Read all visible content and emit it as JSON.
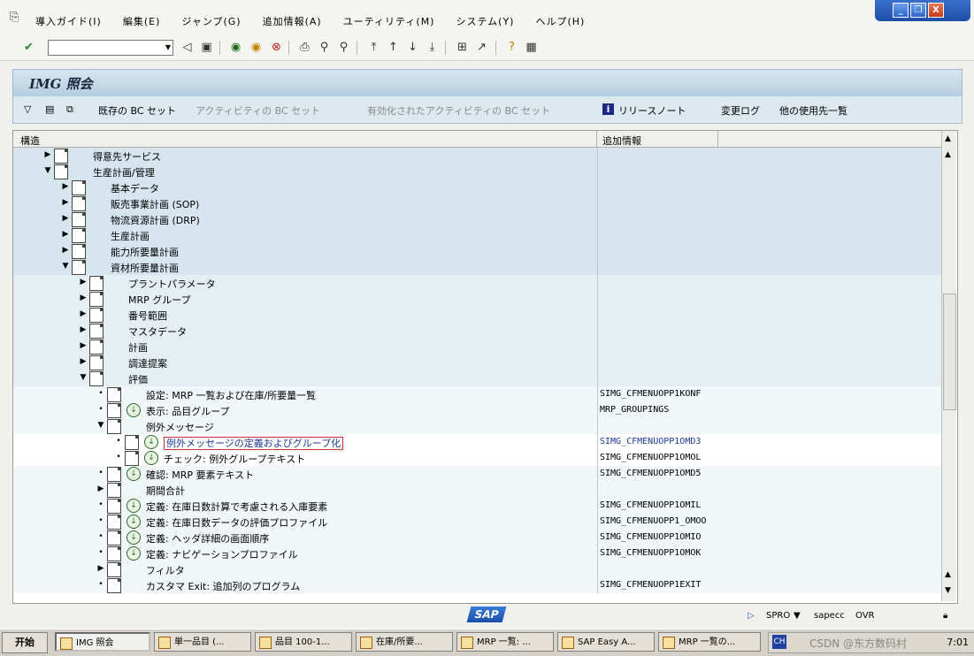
{
  "menubar": {
    "items": [
      "導入ガイド(I)",
      "編集(E)",
      "ジャンプ(G)",
      "追加情報(A)",
      "ユーティリティ(M)",
      "システム(Y)",
      "ヘルプ(H)"
    ]
  },
  "window_controls": {
    "minimize": "_",
    "restore": "❐",
    "close": "X"
  },
  "toolbar": {
    "command_value": ""
  },
  "title": "IMG 照会",
  "app_toolbar": {
    "existing_bc_sets": "既存の BC セット",
    "activity_bc_sets": "アクティビティの BC セット",
    "activated_bc_sets": "有効化されたアクティビティの BC セット",
    "release_notes": "リリースノート",
    "change_log": "変更ログ",
    "where_used": "他の使用先一覧"
  },
  "tree": {
    "headers": {
      "structure": "構造",
      "additional_info": "追加情報"
    },
    "rows": [
      {
        "level": 0,
        "expander": "▶",
        "icon": "doc",
        "clock": false,
        "label": "得意先サービス",
        "code": "",
        "bg": "bg1"
      },
      {
        "level": 0,
        "expander": "▼",
        "icon": "doc",
        "clock": false,
        "label": "生産計画/管理",
        "code": "",
        "bg": "bg1"
      },
      {
        "level": 1,
        "expander": "▶",
        "icon": "doc",
        "clock": false,
        "label": "基本データ",
        "code": "",
        "bg": "bg1"
      },
      {
        "level": 1,
        "expander": "▶",
        "icon": "doc",
        "clock": false,
        "label": "販売事業計画 (SOP)",
        "code": "",
        "bg": "bg1"
      },
      {
        "level": 1,
        "expander": "▶",
        "icon": "doc",
        "clock": false,
        "label": "物流資源計画 (DRP)",
        "code": "",
        "bg": "bg1"
      },
      {
        "level": 1,
        "expander": "▶",
        "icon": "doc",
        "clock": false,
        "label": "生産計画",
        "code": "",
        "bg": "bg1"
      },
      {
        "level": 1,
        "expander": "▶",
        "icon": "doc",
        "clock": false,
        "label": "能力所要量計画",
        "code": "",
        "bg": "bg1"
      },
      {
        "level": 1,
        "expander": "▼",
        "icon": "doc",
        "clock": false,
        "label": "資材所要量計画",
        "code": "",
        "bg": "bg1"
      },
      {
        "level": 2,
        "expander": "▶",
        "icon": "doc",
        "clock": false,
        "label": "プラントパラメータ",
        "code": "",
        "bg": "bg2"
      },
      {
        "level": 2,
        "expander": "▶",
        "icon": "doc",
        "clock": false,
        "label": "MRP グループ",
        "code": "",
        "bg": "bg2"
      },
      {
        "level": 2,
        "expander": "▶",
        "icon": "doc",
        "clock": false,
        "label": "番号範囲",
        "code": "",
        "bg": "bg2"
      },
      {
        "level": 2,
        "expander": "▶",
        "icon": "doc",
        "clock": false,
        "label": "マスタデータ",
        "code": "",
        "bg": "bg2"
      },
      {
        "level": 2,
        "expander": "▶",
        "icon": "doc",
        "clock": false,
        "label": "計画",
        "code": "",
        "bg": "bg2"
      },
      {
        "level": 2,
        "expander": "▶",
        "icon": "doc",
        "clock": false,
        "label": "調達提案",
        "code": "",
        "bg": "bg2"
      },
      {
        "level": 2,
        "expander": "▼",
        "icon": "doc",
        "clock": false,
        "label": "評価",
        "code": "",
        "bg": "bg2"
      },
      {
        "level": 3,
        "expander": "•",
        "icon": "doc",
        "clock": false,
        "label": "設定: MRP 一覧および在庫/所要量一覧",
        "code": "SIMG_CFMENUOPP1KONF",
        "bg": "bg3"
      },
      {
        "level": 3,
        "expander": "•",
        "icon": "doc",
        "clock": true,
        "label": "表示: 品目グループ",
        "code": "MRP_GROUPINGS",
        "bg": "bg3"
      },
      {
        "level": 3,
        "expander": "▼",
        "icon": "doc",
        "clock": false,
        "label": "例外メッセージ",
        "code": "",
        "bg": "bg3"
      },
      {
        "level": 4,
        "expander": "•",
        "icon": "doc",
        "clock": true,
        "label": "例外メッセージの定義およびグループ化",
        "code": "SIMG_CFMENUOPP1OMD3",
        "bg": "bg4",
        "selected": true
      },
      {
        "level": 4,
        "expander": "•",
        "icon": "doc",
        "clock": true,
        "label": "チェック: 例外グループテキスト",
        "code": "SIMG_CFMENUOPP1OMOL",
        "bg": "bg4"
      },
      {
        "level": 3,
        "expander": "•",
        "icon": "doc",
        "clock": true,
        "label": "確認: MRP 要素テキスト",
        "code": "SIMG_CFMENUOPP1OMD5",
        "bg": "bg3"
      },
      {
        "level": 3,
        "expander": "▶",
        "icon": "doc",
        "clock": false,
        "label": "期間合計",
        "code": "",
        "bg": "bg3"
      },
      {
        "level": 3,
        "expander": "•",
        "icon": "doc",
        "clock": true,
        "label": "定義: 在庫日数計算で考慮される入庫要素",
        "code": "SIMG_CFMENUOPP1OMIL",
        "bg": "bg3"
      },
      {
        "level": 3,
        "expander": "•",
        "icon": "doc",
        "clock": true,
        "label": "定義: 在庫日数データの評価プロファイル",
        "code": "SIMG_CFMENUOPP1_OMOO",
        "bg": "bg3"
      },
      {
        "level": 3,
        "expander": "•",
        "icon": "doc",
        "clock": true,
        "label": "定義: ヘッダ詳細の画面順序",
        "code": "SIMG_CFMENUOPP1OMIO",
        "bg": "bg3"
      },
      {
        "level": 3,
        "expander": "•",
        "icon": "doc",
        "clock": true,
        "label": "定義: ナビゲーションプロファイル",
        "code": "SIMG_CFMENUOPP1OMOK",
        "bg": "bg3"
      },
      {
        "level": 3,
        "expander": "▶",
        "icon": "doc",
        "clock": false,
        "label": "フィルタ",
        "code": "",
        "bg": "bg3"
      },
      {
        "level": 3,
        "expander": "•",
        "icon": "doc",
        "clock": false,
        "label": "カスタマ Exit: 追加列のプログラム",
        "code": "SIMG_CFMENUOPP1EXIT",
        "bg": "bg3"
      }
    ]
  },
  "status": {
    "system": "SPRO",
    "server": "sapecc",
    "mode": "OVR"
  },
  "taskbar": {
    "start": "开始",
    "tasks": [
      "IMG 照会",
      "単一品目 (...",
      "品目 100-1...",
      "在庫/所要...",
      "MRP 一覧: ...",
      "SAP Easy A...",
      "MRP 一覧の..."
    ],
    "tray_lang": "CH",
    "watermark": "CSDN @东方数码村",
    "clock": "7:01"
  }
}
